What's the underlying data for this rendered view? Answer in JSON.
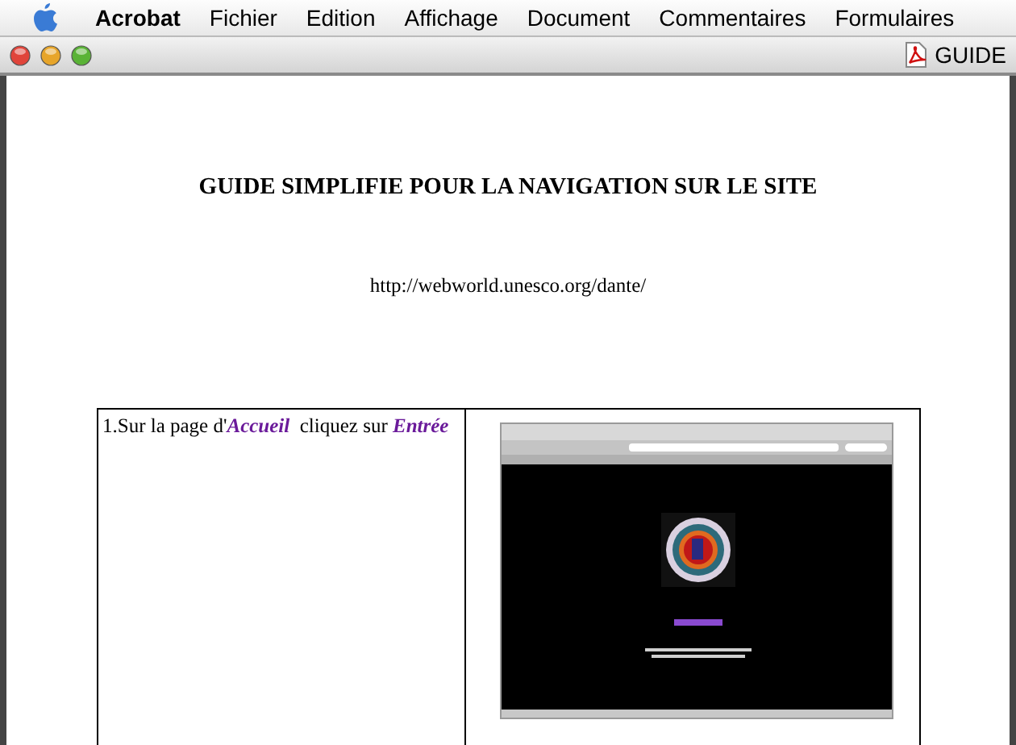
{
  "menu_bar": {
    "items": [
      {
        "label": "Acrobat",
        "kind": "app"
      },
      {
        "label": "Fichier",
        "kind": "menu"
      },
      {
        "label": "Edition",
        "kind": "menu"
      },
      {
        "label": "Affichage",
        "kind": "menu"
      },
      {
        "label": "Document",
        "kind": "menu"
      },
      {
        "label": "Commentaires",
        "kind": "menu"
      },
      {
        "label": "Formulaires",
        "kind": "menu"
      }
    ]
  },
  "window": {
    "title": "GUIDE"
  },
  "document": {
    "heading": "GUIDE SIMPLIFIE POUR LA NAVIGATION SUR LE SITE",
    "url": "http://webworld.unesco.org/dante/",
    "table": {
      "rows": [
        {
          "step": "1.Sur la page d'**Accueil**  cliquez sur **Entrée**"
        }
      ]
    }
  }
}
